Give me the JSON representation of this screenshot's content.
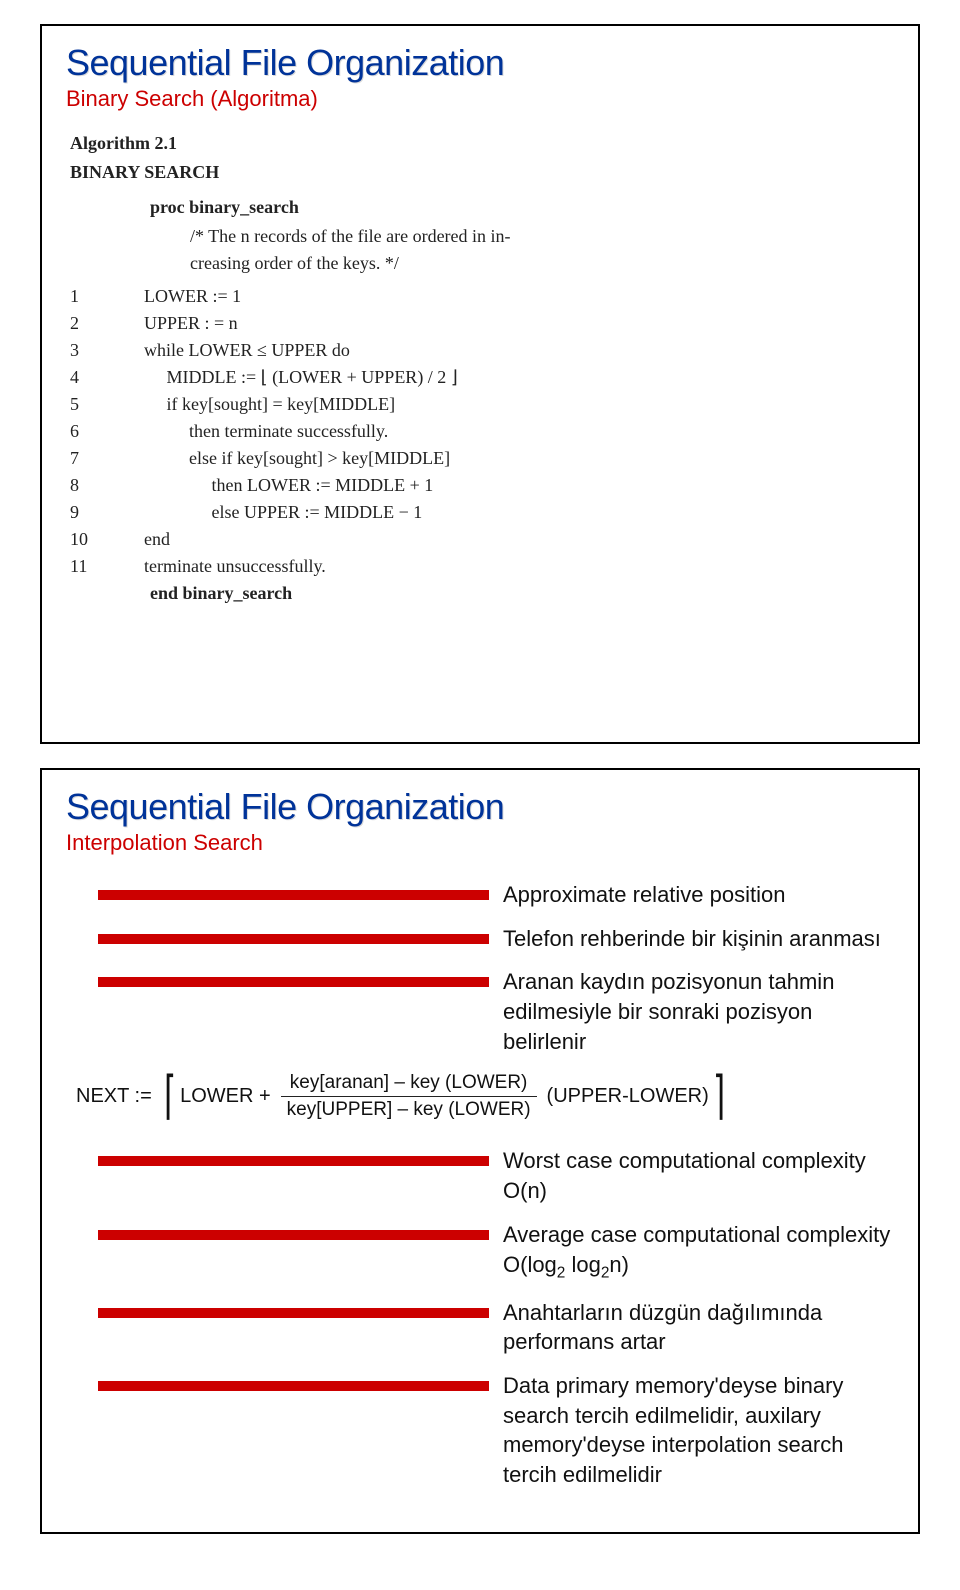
{
  "slide1": {
    "title": "Sequential File Organization",
    "subtitle": "Binary Search (Algoritma)",
    "algo": {
      "header": "Algorithm 2.1",
      "name": "BINARY SEARCH",
      "proc": "proc binary_search",
      "commentLine1": "/*   The n records of the file are ordered in in-",
      "commentLine2": "creasing order of the keys.   */",
      "rows": [
        {
          "n": "1",
          "c": "        LOWER := 1"
        },
        {
          "n": "2",
          "c": "        UPPER : = n"
        },
        {
          "n": "3",
          "c": "        while LOWER ≤ UPPER do"
        },
        {
          "n": "4",
          "c": "             MIDDLE := ⌊ (LOWER + UPPER) / 2 ⌋"
        },
        {
          "n": "5",
          "c": "             if key[sought] = key[MIDDLE]"
        },
        {
          "n": "6",
          "c": "                  then terminate successfully."
        },
        {
          "n": "7",
          "c": "                  else if key[sought] > key[MIDDLE]"
        },
        {
          "n": "8",
          "c": "                       then LOWER := MIDDLE + 1"
        },
        {
          "n": "9",
          "c": "                       else UPPER := MIDDLE − 1"
        },
        {
          "n": "10",
          "c": "        end"
        },
        {
          "n": "11",
          "c": "        terminate unsuccessfully."
        }
      ],
      "end": "end binary_search"
    }
  },
  "slide2": {
    "title": "Sequential File Organization",
    "subtitle": "Interpolation Search",
    "bullets": {
      "b1": "Approximate relative position",
      "b2": "Telefon rehberinde bir kişinin aranması",
      "b3": "Aranan kaydın pozisyonun tahmin edilmesiyle bir sonraki pozisyon belirlenir",
      "b4": "Worst case computational complexity O(n)",
      "b5_pre": "Average case computational complexity O(log",
      "b5_mid": " log",
      "b5_post": "n)",
      "b5_sub": "2",
      "b6": "Anahtarların düzgün dağılımında performans artar",
      "b7": "Data primary memory'deyse binary search tercih edilmelidir, auxilary memory'deyse interpolation search tercih edilmelidir"
    },
    "formula": {
      "lhs": "NEXT :=",
      "lower": "LOWER +",
      "fracTop": "key[aranan] – key (LOWER)",
      "fracBot": "key[UPPER] – key (LOWER)",
      "rhs": "(UPPER-LOWER)"
    }
  }
}
